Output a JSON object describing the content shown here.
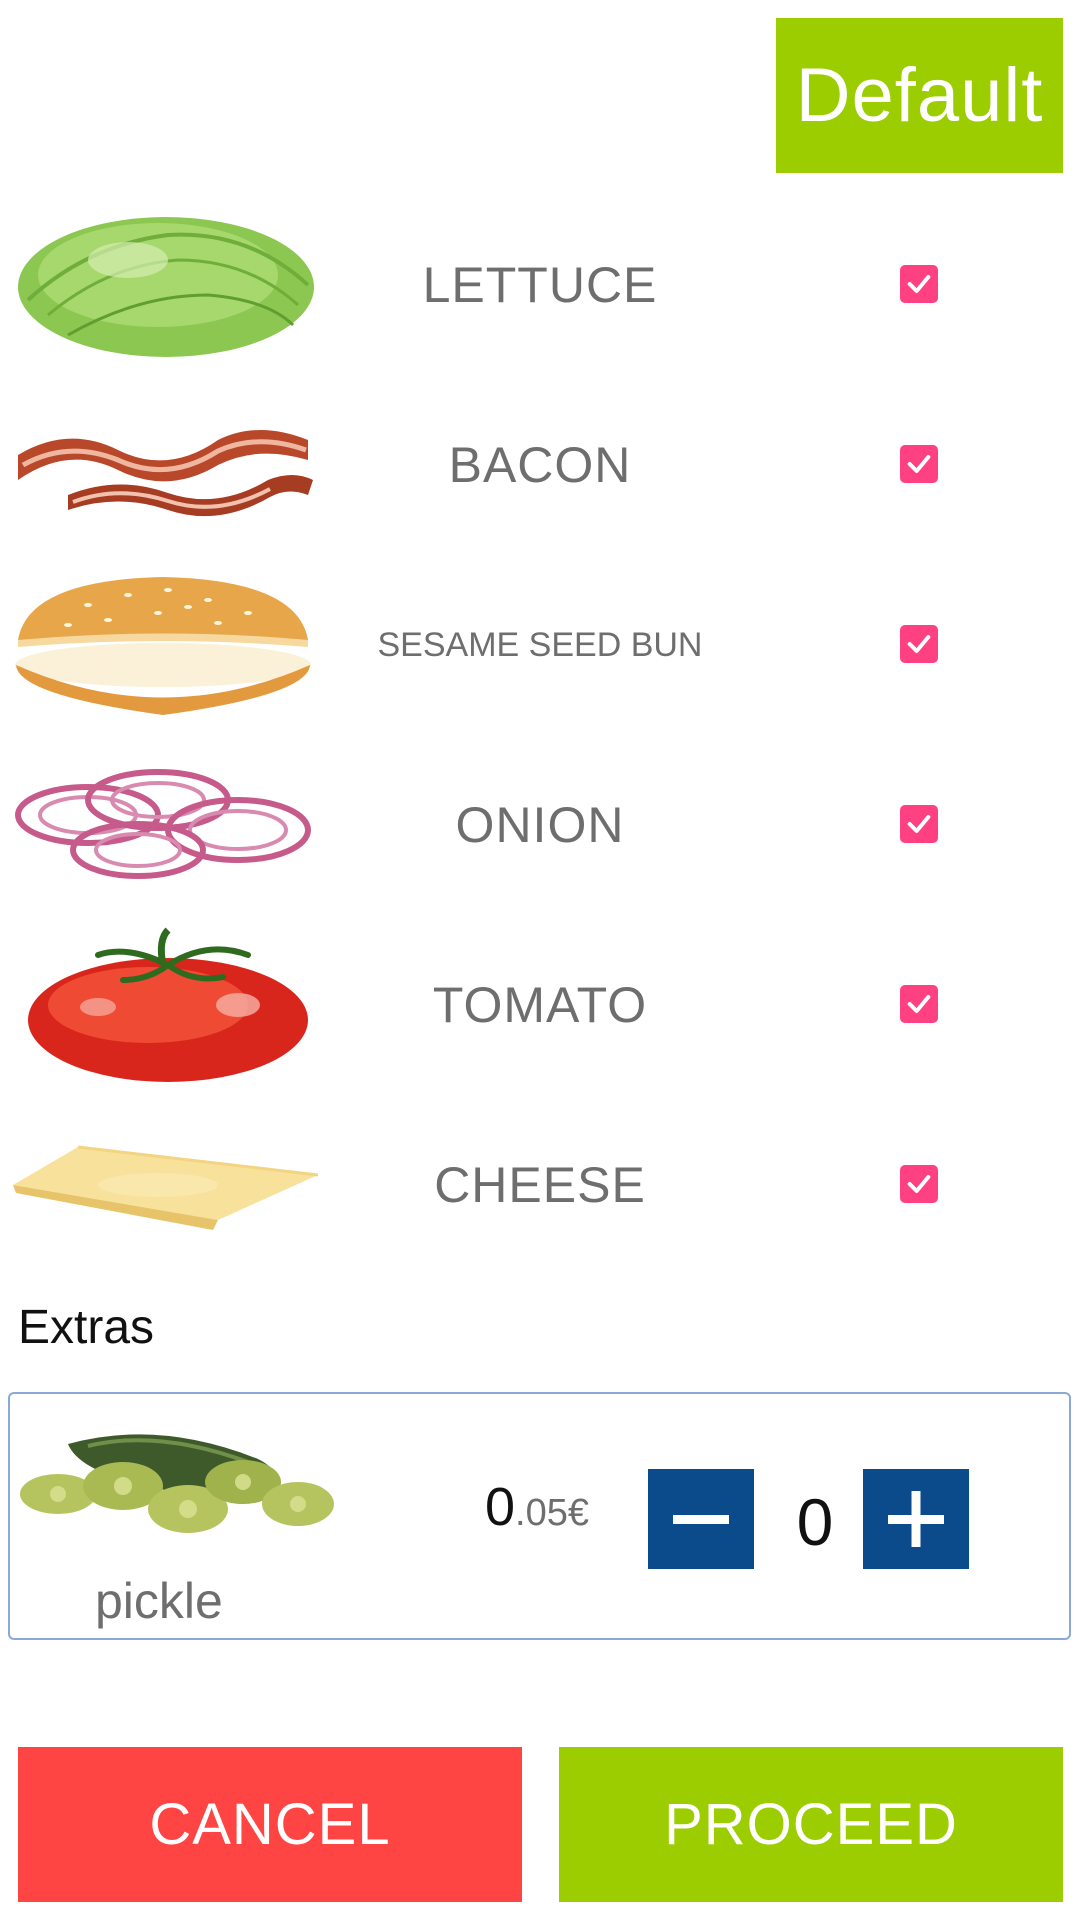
{
  "header": {
    "default_label": "Default"
  },
  "ingredients": [
    {
      "name": "LETTUCE",
      "checked": true,
      "icon": "lettuce-icon"
    },
    {
      "name": "BACON",
      "checked": true,
      "icon": "bacon-icon"
    },
    {
      "name": "SESAME SEED BUN",
      "checked": true,
      "icon": "bun-icon"
    },
    {
      "name": "ONION",
      "checked": true,
      "icon": "onion-icon"
    },
    {
      "name": "TOMATO",
      "checked": true,
      "icon": "tomato-icon"
    },
    {
      "name": "CHEESE",
      "checked": true,
      "icon": "cheese-icon"
    }
  ],
  "extras": {
    "title": "Extras",
    "items": [
      {
        "name": "pickle",
        "price_whole": "0",
        "price_rest": ".05€",
        "quantity": "0",
        "icon": "pickle-icon"
      }
    ]
  },
  "footer": {
    "cancel_label": "CANCEL",
    "proceed_label": "PROCEED"
  },
  "colors": {
    "accent_green": "#9BCD00",
    "cancel_red": "#FF4444",
    "checkbox_pink": "#FF4081",
    "stepper_blue": "#0B4A8B"
  }
}
